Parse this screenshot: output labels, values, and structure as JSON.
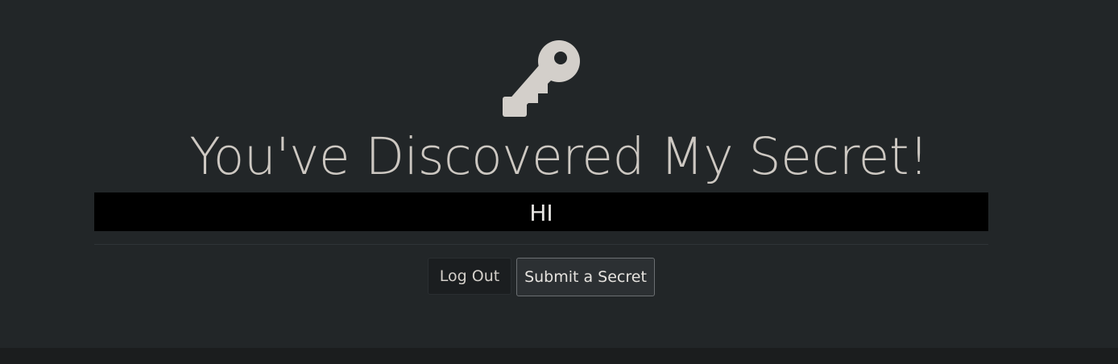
{
  "icon": {
    "name": "key-icon",
    "color": "#d3cfca"
  },
  "heading": {
    "title": "You've Discovered My Secret!"
  },
  "secret": {
    "text": "HI"
  },
  "actions": {
    "logout_label": "Log Out",
    "submit_label": "Submit a Secret"
  },
  "colors": {
    "background": "#222628",
    "secret_bar": "#000000",
    "footer": "#1b1d1e"
  }
}
